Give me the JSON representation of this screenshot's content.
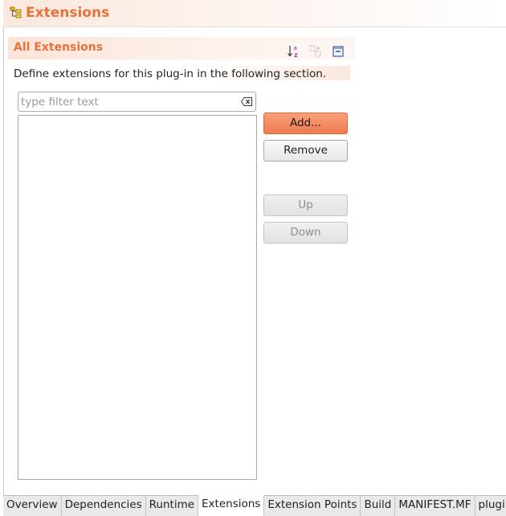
{
  "page": {
    "title": "Extensions",
    "icon": "extensions-icon"
  },
  "section": {
    "title": "All Extensions",
    "description": "Define extensions for this plug-in in the following section.",
    "toolbar": {
      "sort_icon": "sort-alphabetical-icon",
      "expand_icon": "expand-all-icon",
      "collapse_icon": "collapse-all-icon"
    }
  },
  "filter": {
    "value": "",
    "placeholder": "type filter text",
    "clear_icon": "clear-filter-icon"
  },
  "buttons": {
    "add": "Add...",
    "remove": "Remove",
    "up": "Up",
    "down": "Down"
  },
  "tabs": [
    {
      "label": "Overview"
    },
    {
      "label": "Dependencies"
    },
    {
      "label": "Runtime"
    },
    {
      "label": "Extensions",
      "active": true
    },
    {
      "label": "Extension Points"
    },
    {
      "label": "Build"
    },
    {
      "label": "MANIFEST.MF"
    },
    {
      "label": "plugin"
    }
  ],
  "colors": {
    "accent": "#e8733a",
    "primary_button": "#ef7a4e"
  }
}
